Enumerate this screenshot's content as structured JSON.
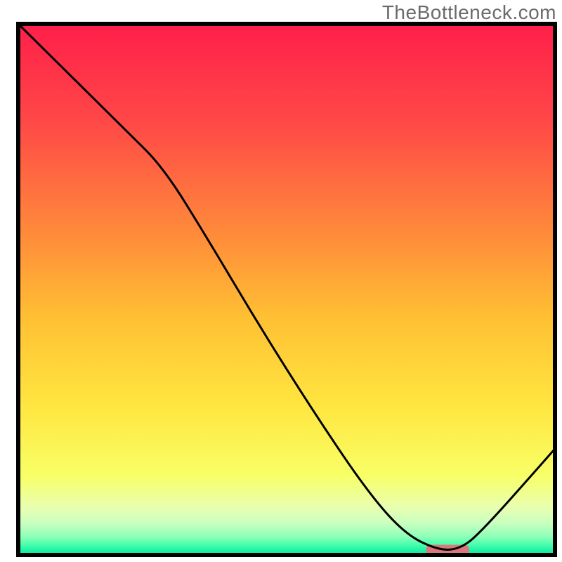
{
  "watermark": "TheBottleneck.com",
  "chart_data": {
    "type": "line",
    "title": "",
    "xlabel": "",
    "ylabel": "",
    "xlim": [
      0,
      100
    ],
    "ylim": [
      0,
      100
    ],
    "series": [
      {
        "name": "bottleneck-curve",
        "x": [
          0,
          10,
          20,
          27,
          35,
          45,
          55,
          65,
          72,
          78,
          82,
          86,
          100
        ],
        "values": [
          100,
          90,
          80,
          73,
          60,
          43,
          27,
          12,
          4,
          1,
          1,
          4,
          20
        ]
      }
    ],
    "marker": {
      "name": "optimal-zone",
      "x_start": 76,
      "x_end": 84,
      "y": 1,
      "color": "#d9777a"
    },
    "background_gradient": {
      "stops": [
        {
          "y_pct": 0,
          "color": "#ff1f4a"
        },
        {
          "y_pct": 18,
          "color": "#ff4747"
        },
        {
          "y_pct": 40,
          "color": "#ff8c3a"
        },
        {
          "y_pct": 55,
          "color": "#ffbf33"
        },
        {
          "y_pct": 72,
          "color": "#ffe640"
        },
        {
          "y_pct": 85,
          "color": "#f8ff66"
        },
        {
          "y_pct": 91,
          "color": "#e9ffb0"
        },
        {
          "y_pct": 94,
          "color": "#c9ffbf"
        },
        {
          "y_pct": 96.5,
          "color": "#8fffb8"
        },
        {
          "y_pct": 98,
          "color": "#4affad"
        },
        {
          "y_pct": 100,
          "color": "#00e6a0"
        }
      ]
    },
    "frame_color": "#000000",
    "curve_color": "#000000",
    "grid": false,
    "legend": false
  }
}
